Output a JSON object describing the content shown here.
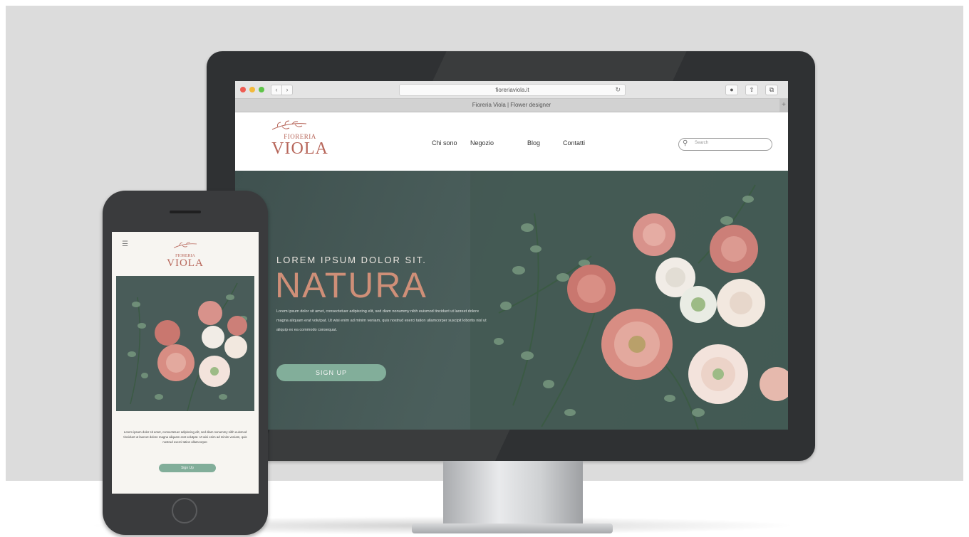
{
  "browser": {
    "url": "fioreriaviola.it",
    "tab_title": "Fioreria Viola | Flower designer",
    "back_icon": "chevron-left-icon",
    "forward_icon": "chevron-right-icon",
    "reload_icon": "reload-icon",
    "tool_icons": [
      "download-icon",
      "share-icon",
      "tabs-icon"
    ]
  },
  "site": {
    "logo": {
      "top": "FIORERIA",
      "main": "VIOLA"
    },
    "nav": [
      "Chi sono",
      "Negozio",
      "Blog",
      "Contatti"
    ],
    "search_placeholder": "Search",
    "hero": {
      "kicker": "LOREM IPSUM DOLOR SIT.",
      "headline": "NATURA",
      "body": "Lorem ipsum dolor sit amet, consectetuer adipiscing elit, sed diam nonummy nibh euismod tincidunt ut laoreet dolore magna aliquam erat volutpat. Ut wisi enim ad minim veniam, quis nostrud exerci tation ullamcorper suscipit lobortis nisl ut aliquip ex ea commodo consequat.",
      "cta": "SIGN UP"
    }
  },
  "mobile": {
    "logo": {
      "top": "FIORERIA",
      "main": "VIOLA"
    },
    "menu_icon": "hamburger-menu-icon",
    "body": "Lorem ipsum dolor sit amet, consectetuer adipiscing elit, sed diam nonummy nibh euismod tincidunt ut laoreet dolore magna aliquam erat volutpat. Ut wisi enim ad minim veniam, quis nostrud exerci tation ullamcorper.",
    "cta": "Sign Up"
  },
  "colors": {
    "brand": "#b7665a",
    "headline": "#cf8f78",
    "accent": "#82ae9a",
    "hero_bg": "#4a5d5b",
    "device": "#2f3133"
  }
}
